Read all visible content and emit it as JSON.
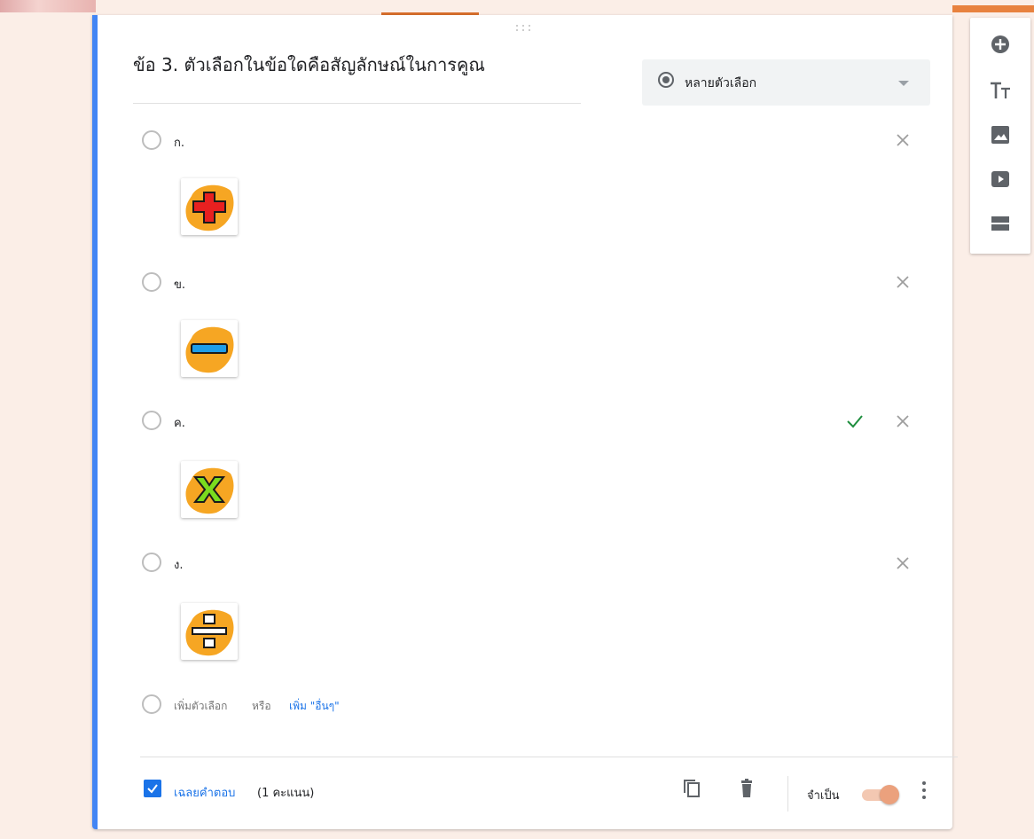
{
  "question": {
    "title": "ข้อ 3. ตัวเลือกในข้อใดคือสัญลักษณ์ในการคูณ",
    "type_label": "หลายตัวเลือก"
  },
  "options": [
    {
      "label": "ก.",
      "image_icon": "plus-symbol-icon",
      "correct": false
    },
    {
      "label": "ข.",
      "image_icon": "minus-symbol-icon",
      "correct": false
    },
    {
      "label": "ค.",
      "image_icon": "multiply-symbol-icon",
      "correct": true
    },
    {
      "label": "ง.",
      "image_icon": "divide-symbol-icon",
      "correct": false
    }
  ],
  "add_option": {
    "add_label": "เพิ่มตัวเลือก",
    "or_label": "หรือ",
    "other_label": "เพิ่ม \"อื่นๆ\""
  },
  "footer": {
    "answer_key_label": "เฉลยคำตอบ",
    "points_label": "(1 คะแนน)",
    "required_label": "จำเป็น",
    "required_on": true
  },
  "side_toolbar": [
    "add-question-icon",
    "add-title-icon",
    "add-image-icon",
    "add-video-icon",
    "add-section-icon"
  ],
  "colors": {
    "accent_blue": "#4285f4",
    "link_blue": "#1a73e8",
    "correct_green": "#1e8e3e",
    "toggle_thumb": "#eba17d",
    "page_bg": "#fbeee7"
  }
}
